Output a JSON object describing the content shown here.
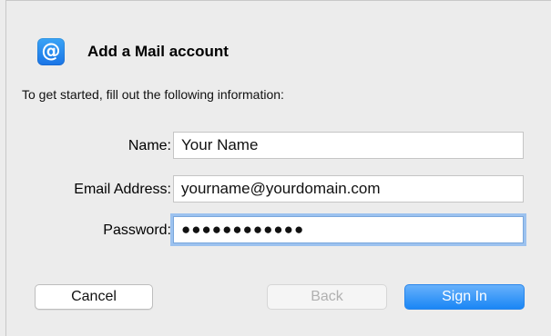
{
  "dialog": {
    "title": "Add a Mail account",
    "icon": "at-sign-icon",
    "icon_color": "#2a8cf2",
    "intro": "To get started, fill out the following information:"
  },
  "form": {
    "name_label": "Name:",
    "name_value": "Your Name",
    "email_label": "Email Address:",
    "email_value": "yourname@yourdomain.com",
    "password_label": "Password:",
    "password_value": "●●●●●●●●●●●●"
  },
  "buttons": {
    "cancel": "Cancel",
    "back": "Back",
    "sign_in": "Sign In",
    "sign_in_color": "#1a86f5"
  }
}
